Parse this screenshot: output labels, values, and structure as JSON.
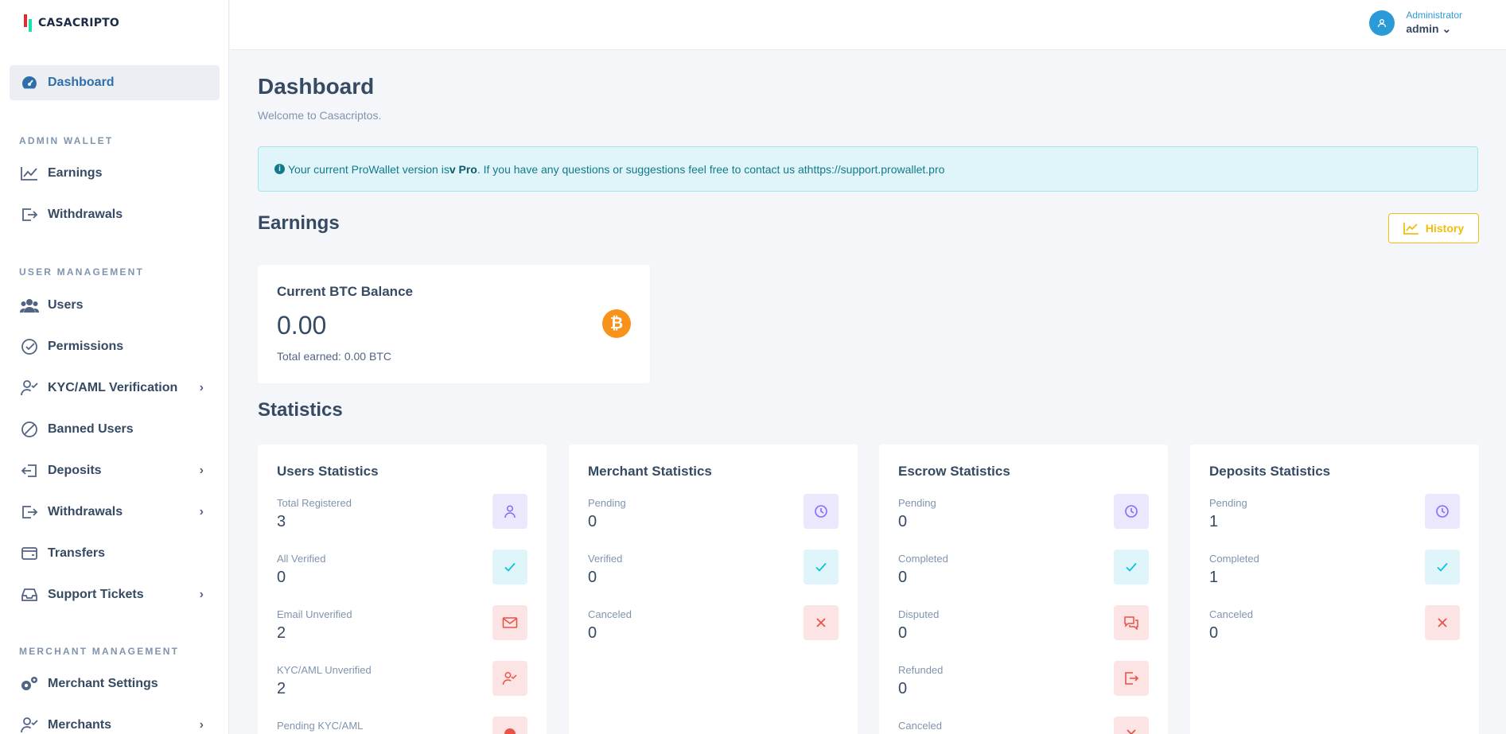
{
  "brand": {
    "name": "CASACRIPTO"
  },
  "sidebar": {
    "dashboard": "Dashboard",
    "admin_wallet_heading": "ADMIN WALLET",
    "earnings": "Earnings",
    "withdrawals_wallet": "Withdrawals",
    "user_management_heading": "USER MANAGEMENT",
    "users": "Users",
    "permissions": "Permissions",
    "kyc": "KYC/AML Verification",
    "banned": "Banned Users",
    "deposits": "Deposits",
    "withdrawals": "Withdrawals",
    "transfers": "Transfers",
    "support": "Support Tickets",
    "merchant_management_heading": "MERCHANT MANAGEMENT",
    "merchant_settings": "Merchant Settings",
    "merchants": "Merchants"
  },
  "header": {
    "role": "Administrator",
    "username": "admin"
  },
  "page": {
    "title": "Dashboard",
    "subtitle": "Welcome to Casacriptos."
  },
  "alert": {
    "prefix": "Your current ProWallet version is ",
    "version": "v Pro",
    "middle": ". If you have any questions or suggestions feel free to contact us at ",
    "link": "https://support.prowallet.pro"
  },
  "earnings": {
    "title": "Earnings",
    "history_label": "History",
    "btc_card": {
      "title": "Current BTC Balance",
      "amount": "0.00",
      "total": "Total earned: 0.00 BTC"
    }
  },
  "statistics": {
    "title": "Statistics",
    "users": {
      "title": "Users Statistics",
      "rows": [
        {
          "label": "Total Registered",
          "value": "3"
        },
        {
          "label": "All Verified",
          "value": "0"
        },
        {
          "label": "Email Unverified",
          "value": "2"
        },
        {
          "label": "KYC/AML Unverified",
          "value": "2"
        },
        {
          "label": "Pending KYC/AML",
          "value": ""
        }
      ]
    },
    "merchant": {
      "title": "Merchant Statistics",
      "rows": [
        {
          "label": "Pending",
          "value": "0"
        },
        {
          "label": "Verified",
          "value": "0"
        },
        {
          "label": "Canceled",
          "value": "0"
        }
      ]
    },
    "escrow": {
      "title": "Escrow Statistics",
      "rows": [
        {
          "label": "Pending",
          "value": "0"
        },
        {
          "label": "Completed",
          "value": "0"
        },
        {
          "label": "Disputed",
          "value": "0"
        },
        {
          "label": "Refunded",
          "value": "0"
        },
        {
          "label": "Canceled",
          "value": ""
        }
      ]
    },
    "deposits": {
      "title": "Deposits Statistics",
      "rows": [
        {
          "label": "Pending",
          "value": "1"
        },
        {
          "label": "Completed",
          "value": "1"
        },
        {
          "label": "Canceled",
          "value": "0"
        }
      ]
    }
  },
  "colors": {
    "accent": "#2a9bd6",
    "warning": "#f4bd0e",
    "bitcoin": "#f7931a"
  }
}
